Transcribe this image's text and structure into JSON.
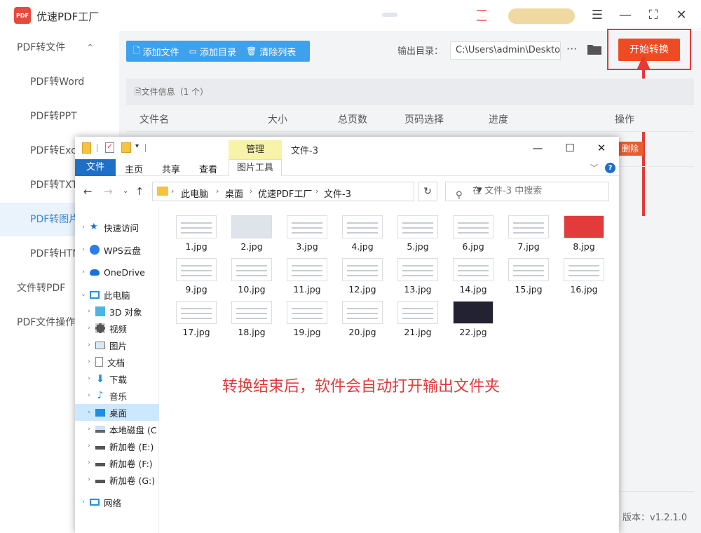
{
  "app": {
    "title": "优速PDF工厂",
    "logo_text": "PDF"
  },
  "sidebar": {
    "items": [
      {
        "label": "PDF转文件",
        "expand": "^"
      },
      {
        "label": "PDF转Word"
      },
      {
        "label": "PDF转PPT"
      },
      {
        "label": "PDF转Exc"
      },
      {
        "label": "PDF转TXT"
      },
      {
        "label": "PDF转图片"
      },
      {
        "label": "PDF转HTM"
      },
      {
        "label": "文件转PDF"
      },
      {
        "label": "PDF文件操作"
      }
    ],
    "active_index": 5
  },
  "toolbar": {
    "add_file": "添加文件",
    "add_dir": "添加目录",
    "clear": "清除列表"
  },
  "output": {
    "label": "输出目录：",
    "path": "C:\\Users\\admin\\Deskto",
    "more": "···"
  },
  "start_button": "开始转换",
  "file_info": "文件信息（1 个）",
  "table": {
    "headers": [
      "文件名",
      "大小",
      "总页数",
      "页码选择",
      "进度",
      "操作"
    ],
    "delete": "删除"
  },
  "version": "版本：v1.2.1.0",
  "explorer": {
    "manage_tab": "管理",
    "folder_title": "文件-3",
    "ribbon": {
      "file": "文件",
      "tabs": [
        "主页",
        "共享",
        "查看"
      ],
      "pic_tools": "图片工具"
    },
    "breadcrumb": [
      "此电脑",
      "桌面",
      "优速PDF工厂",
      "文件-3"
    ],
    "search_placeholder": "在 文件-3 中搜索",
    "nav": [
      {
        "label": "快速访问",
        "icon": "star-icon"
      },
      {
        "label": "WPS云盘",
        "icon": "cloud-icon"
      },
      {
        "label": "OneDrive",
        "icon": "onedrive-icon"
      },
      {
        "label": "此电脑",
        "icon": "computer-icon"
      },
      {
        "label": "3D 对象",
        "icon": "cube-icon"
      },
      {
        "label": "视频",
        "icon": "video-icon"
      },
      {
        "label": "图片",
        "icon": "picture-icon"
      },
      {
        "label": "文档",
        "icon": "document-icon"
      },
      {
        "label": "下载",
        "icon": "download-icon"
      },
      {
        "label": "音乐",
        "icon": "music-icon"
      },
      {
        "label": "桌面",
        "icon": "desktop-icon"
      },
      {
        "label": "本地磁盘 (C",
        "icon": "drive-icon"
      },
      {
        "label": "新加卷 (E:)",
        "icon": "drive-icon"
      },
      {
        "label": "新加卷 (F:)",
        "icon": "drive-icon"
      },
      {
        "label": "新加卷 (G:)",
        "icon": "drive-icon"
      },
      {
        "label": "网络",
        "icon": "network-icon"
      }
    ],
    "files": [
      "1.jpg",
      "2.jpg",
      "3.jpg",
      "4.jpg",
      "5.jpg",
      "6.jpg",
      "7.jpg",
      "8.jpg",
      "9.jpg",
      "10.jpg",
      "11.jpg",
      "12.jpg",
      "13.jpg",
      "14.jpg",
      "15.jpg",
      "16.jpg",
      "17.jpg",
      "18.jpg",
      "19.jpg",
      "20.jpg",
      "21.jpg",
      "22.jpg"
    ]
  },
  "annotation": "转换结束后，软件会自动打开输出文件夹",
  "colors": {
    "accent_blue": "#3fa1ec",
    "start_orange": "#ef4b22",
    "annotation_red": "#e23a3a",
    "explorer_blue": "#1e6fc6"
  }
}
